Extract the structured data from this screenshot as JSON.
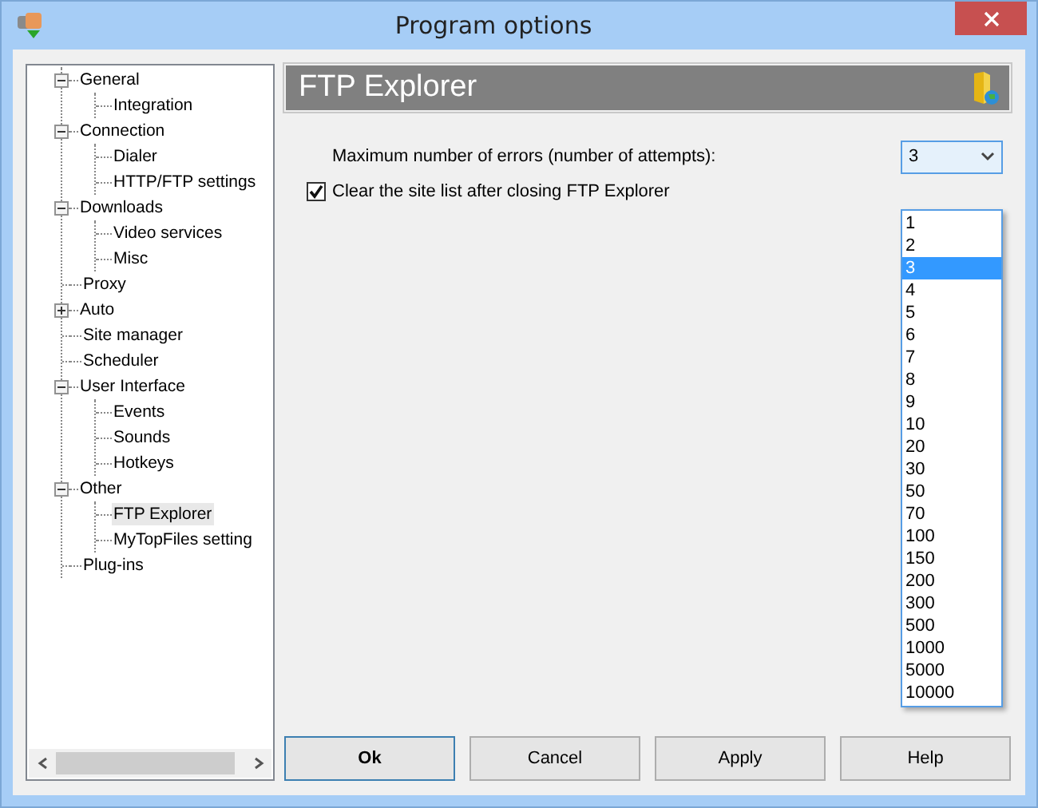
{
  "window": {
    "title": "Program options"
  },
  "tree": [
    {
      "label": "General",
      "expanded": true,
      "selected": false,
      "children": [
        {
          "label": "Integration",
          "selected": false
        }
      ]
    },
    {
      "label": "Connection",
      "expanded": true,
      "selected": false,
      "children": [
        {
          "label": "Dialer",
          "selected": false
        },
        {
          "label": "HTTP/FTP settings",
          "selected": false
        }
      ]
    },
    {
      "label": "Downloads",
      "expanded": true,
      "selected": false,
      "children": [
        {
          "label": "Video services",
          "selected": false
        },
        {
          "label": "Misc",
          "selected": false
        }
      ]
    },
    {
      "label": "Proxy",
      "selected": false
    },
    {
      "label": "Auto",
      "expanded": false,
      "selected": false
    },
    {
      "label": "Site manager",
      "selected": false
    },
    {
      "label": "Scheduler",
      "selected": false
    },
    {
      "label": "User Interface",
      "expanded": true,
      "selected": false,
      "children": [
        {
          "label": "Events",
          "selected": false
        },
        {
          "label": "Sounds",
          "selected": false
        },
        {
          "label": "Hotkeys",
          "selected": false
        }
      ]
    },
    {
      "label": "Other",
      "expanded": true,
      "selected": false,
      "children": [
        {
          "label": "FTP Explorer",
          "selected": true
        },
        {
          "label": "MyTopFiles setting",
          "selected": false
        }
      ]
    },
    {
      "label": "Plug-ins",
      "selected": false
    }
  ],
  "panel": {
    "title": "FTP Explorer",
    "max_errors": {
      "label": "Maximum number of errors (number of attempts):",
      "value": "3",
      "options": [
        {
          "label": "1",
          "selected": false
        },
        {
          "label": "2",
          "selected": false
        },
        {
          "label": "3",
          "selected": true
        },
        {
          "label": "4",
          "selected": false
        },
        {
          "label": "5",
          "selected": false
        },
        {
          "label": "6",
          "selected": false
        },
        {
          "label": "7",
          "selected": false
        },
        {
          "label": "8",
          "selected": false
        },
        {
          "label": "9",
          "selected": false
        },
        {
          "label": "10",
          "selected": false
        },
        {
          "label": "20",
          "selected": false
        },
        {
          "label": "30",
          "selected": false
        },
        {
          "label": "50",
          "selected": false
        },
        {
          "label": "70",
          "selected": false
        },
        {
          "label": "100",
          "selected": false
        },
        {
          "label": "150",
          "selected": false
        },
        {
          "label": "200",
          "selected": false
        },
        {
          "label": "300",
          "selected": false
        },
        {
          "label": "500",
          "selected": false
        },
        {
          "label": "1000",
          "selected": false
        },
        {
          "label": "5000",
          "selected": false
        },
        {
          "label": "10000",
          "selected": false
        }
      ]
    },
    "clear_list": {
      "label": "Clear the site list after closing FTP Explorer",
      "checked": true
    }
  },
  "buttons": [
    {
      "label": "Ok",
      "default": true
    },
    {
      "label": "Cancel",
      "default": false
    },
    {
      "label": "Apply",
      "default": false
    },
    {
      "label": "Help",
      "default": false
    }
  ]
}
